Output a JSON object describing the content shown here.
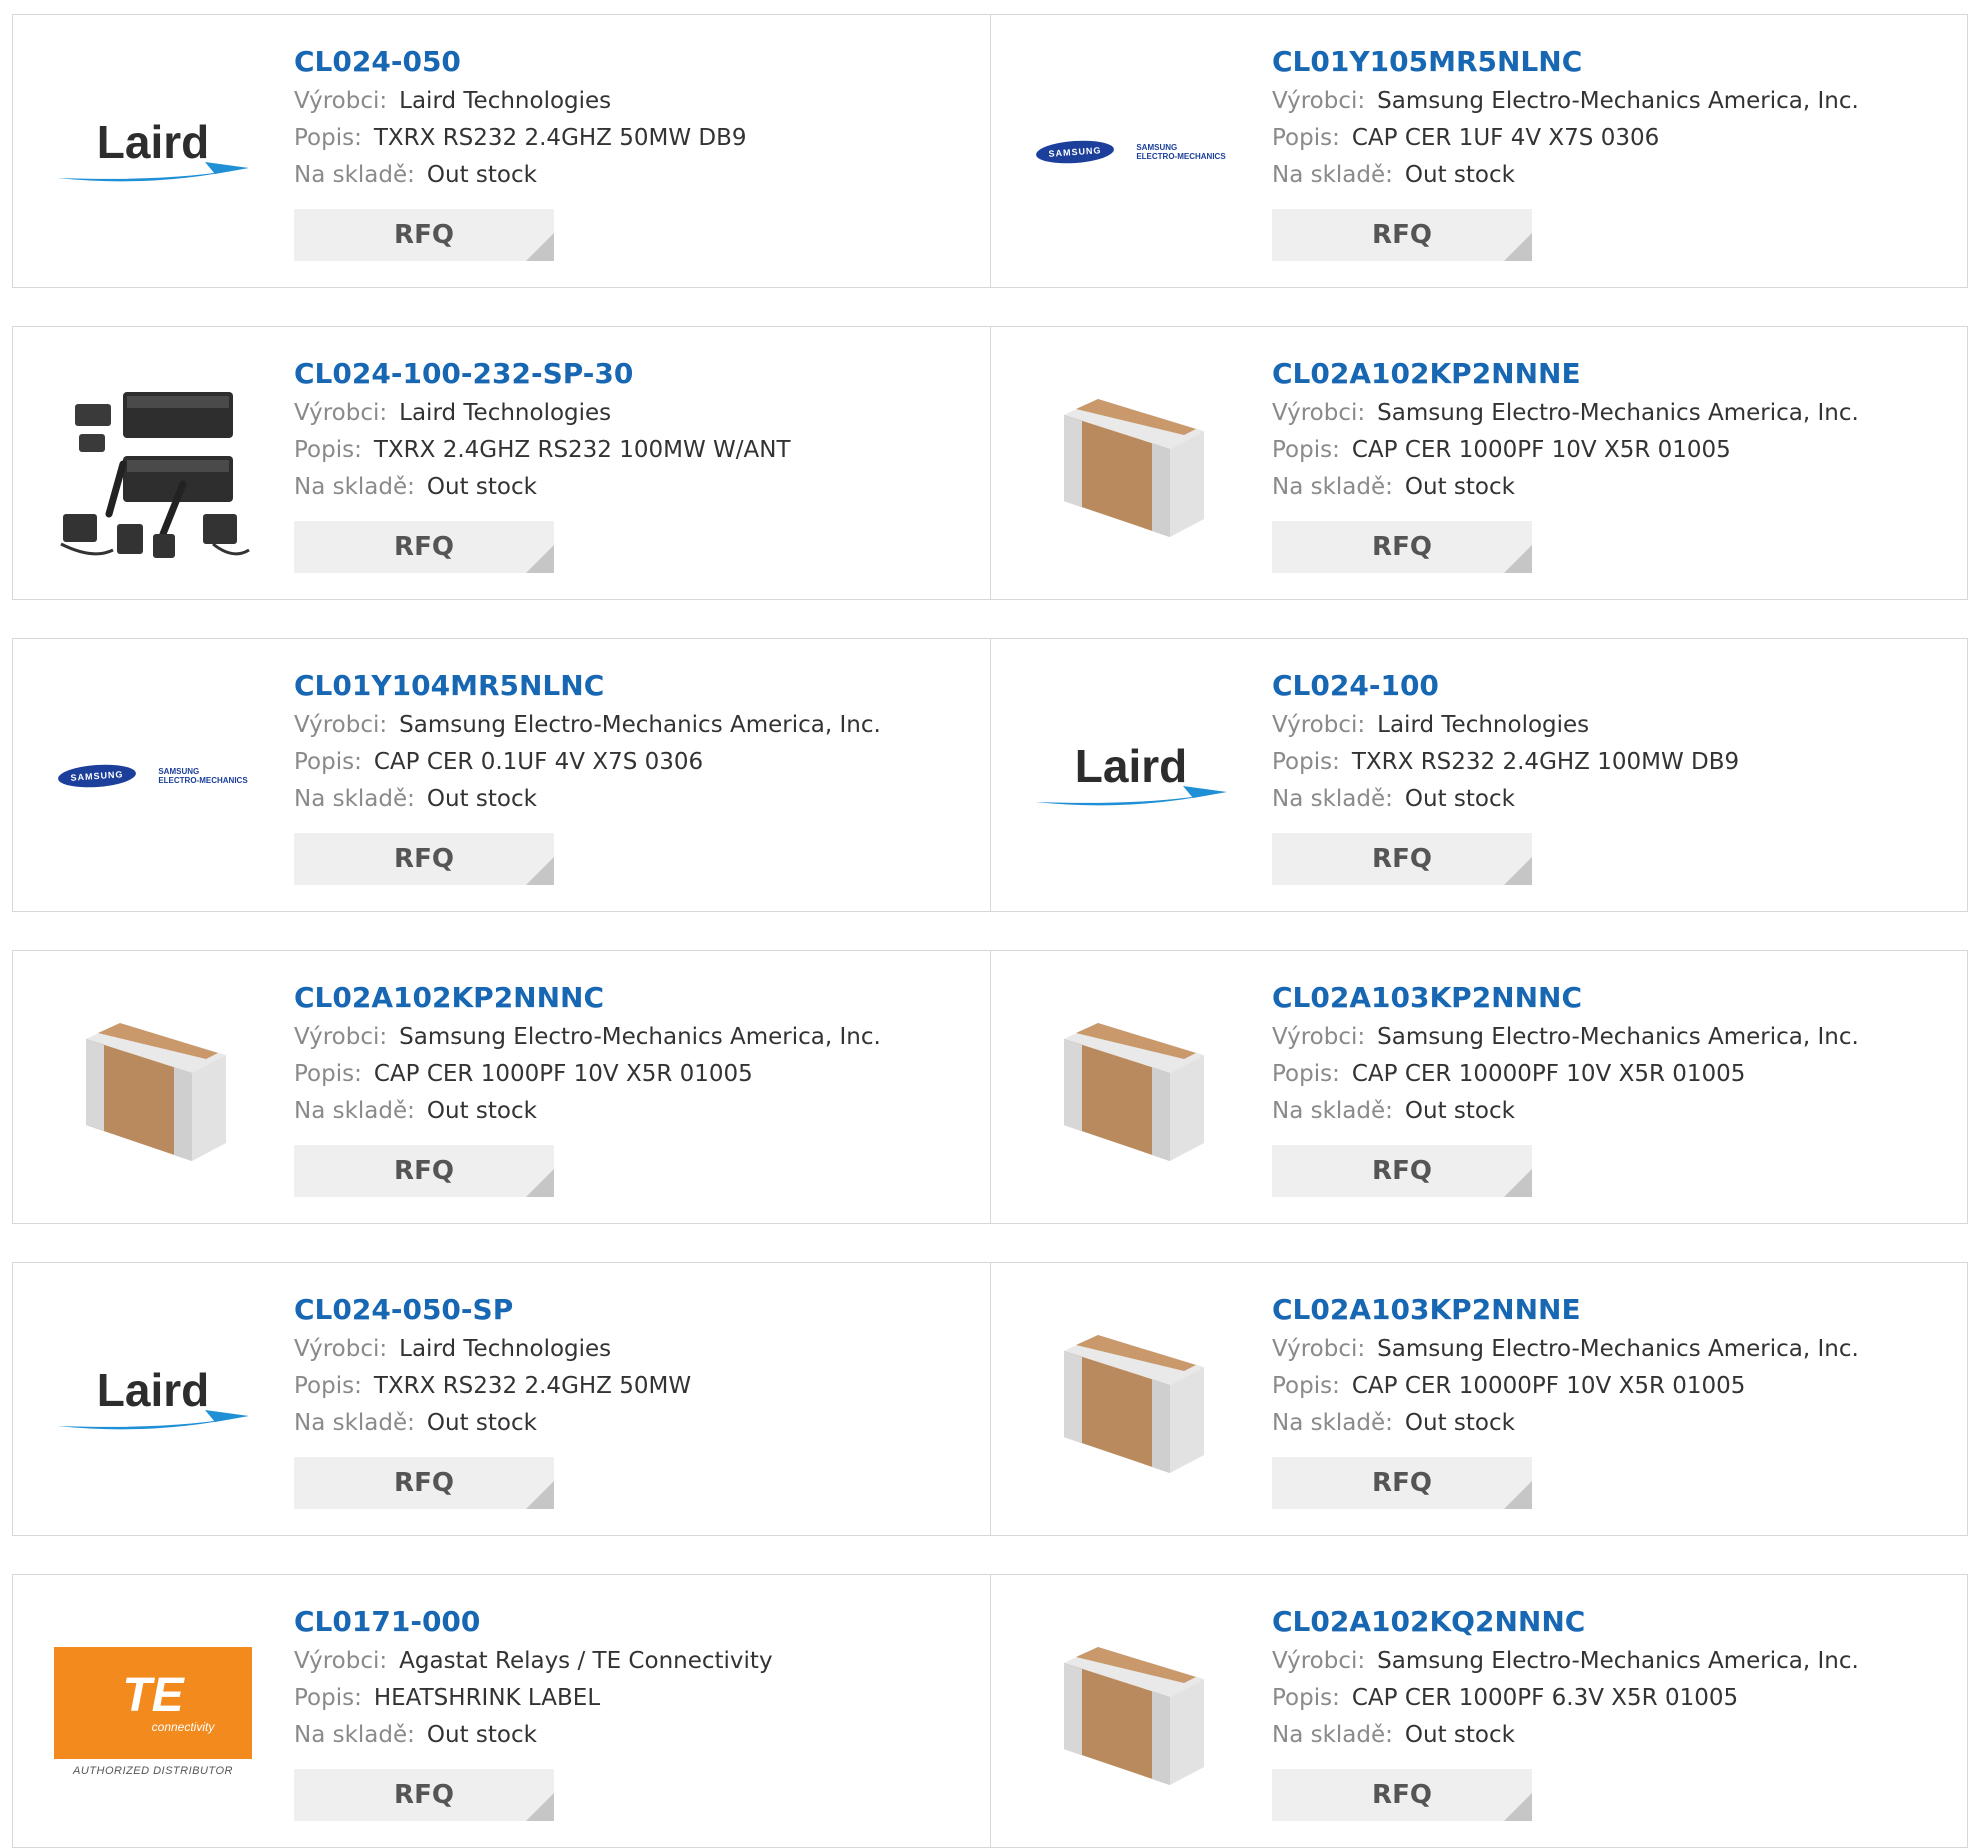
{
  "labels": {
    "manufacturer": "Výrobci:",
    "description": "Popis:",
    "stock": "Na skladě:",
    "rfq": "RFQ"
  },
  "logo_text": {
    "laird": "Laird",
    "samsung": "SAMSUNG",
    "samsung_sub_1": "SAMSUNG",
    "samsung_sub_2": "ELECTRO-MECHANICS",
    "te": "TE",
    "te_connectivity": "connectivity",
    "te_authorized": "AUTHORIZED DISTRIBUTOR"
  },
  "products": [
    {
      "part": "CL024-050",
      "manufacturer": "Laird Technologies",
      "description": "TXRX RS232 2.4GHZ 50MW DB9",
      "stock": "Out stock",
      "thumb": "laird-logo"
    },
    {
      "part": "CL01Y105MR5NLNC",
      "manufacturer": "Samsung Electro-Mechanics America, Inc.",
      "description": "CAP CER 1UF 4V X7S 0306",
      "stock": "Out stock",
      "thumb": "samsung-logo"
    },
    {
      "part": "CL024-100-232-SP-30",
      "manufacturer": "Laird Technologies",
      "description": "TXRX 2.4GHZ RS232 100MW W/ANT",
      "stock": "Out stock",
      "thumb": "radio-kit-photo"
    },
    {
      "part": "CL02A102KP2NNNE",
      "manufacturer": "Samsung Electro-Mechanics America, Inc.",
      "description": "CAP CER 1000PF 10V X5R 01005",
      "stock": "Out stock",
      "thumb": "chip-capacitor"
    },
    {
      "part": "CL01Y104MR5NLNC",
      "manufacturer": "Samsung Electro-Mechanics America, Inc.",
      "description": "CAP CER 0.1UF 4V X7S 0306",
      "stock": "Out stock",
      "thumb": "samsung-logo"
    },
    {
      "part": "CL024-100",
      "manufacturer": "Laird Technologies",
      "description": "TXRX RS232 2.4GHZ 100MW DB9",
      "stock": "Out stock",
      "thumb": "laird-logo"
    },
    {
      "part": "CL02A102KP2NNNC",
      "manufacturer": "Samsung Electro-Mechanics America, Inc.",
      "description": "CAP CER 1000PF 10V X5R 01005",
      "stock": "Out stock",
      "thumb": "chip-capacitor"
    },
    {
      "part": "CL02A103KP2NNNC",
      "manufacturer": "Samsung Electro-Mechanics America, Inc.",
      "description": "CAP CER 10000PF 10V X5R 01005",
      "stock": "Out stock",
      "thumb": "chip-capacitor"
    },
    {
      "part": "CL024-050-SP",
      "manufacturer": "Laird Technologies",
      "description": "TXRX RS232 2.4GHZ 50MW",
      "stock": "Out stock",
      "thumb": "laird-logo"
    },
    {
      "part": "CL02A103KP2NNNE",
      "manufacturer": "Samsung Electro-Mechanics America, Inc.",
      "description": "CAP CER 10000PF 10V X5R 01005",
      "stock": "Out stock",
      "thumb": "chip-capacitor"
    },
    {
      "part": "CL0171-000",
      "manufacturer": "Agastat Relays / TE Connectivity",
      "description": "HEATSHRINK LABEL",
      "stock": "Out stock",
      "thumb": "te-logo"
    },
    {
      "part": "CL02A102KQ2NNNC",
      "manufacturer": "Samsung Electro-Mechanics America, Inc.",
      "description": "CAP CER 1000PF 6.3V X5R 01005",
      "stock": "Out stock",
      "thumb": "chip-capacitor"
    }
  ]
}
